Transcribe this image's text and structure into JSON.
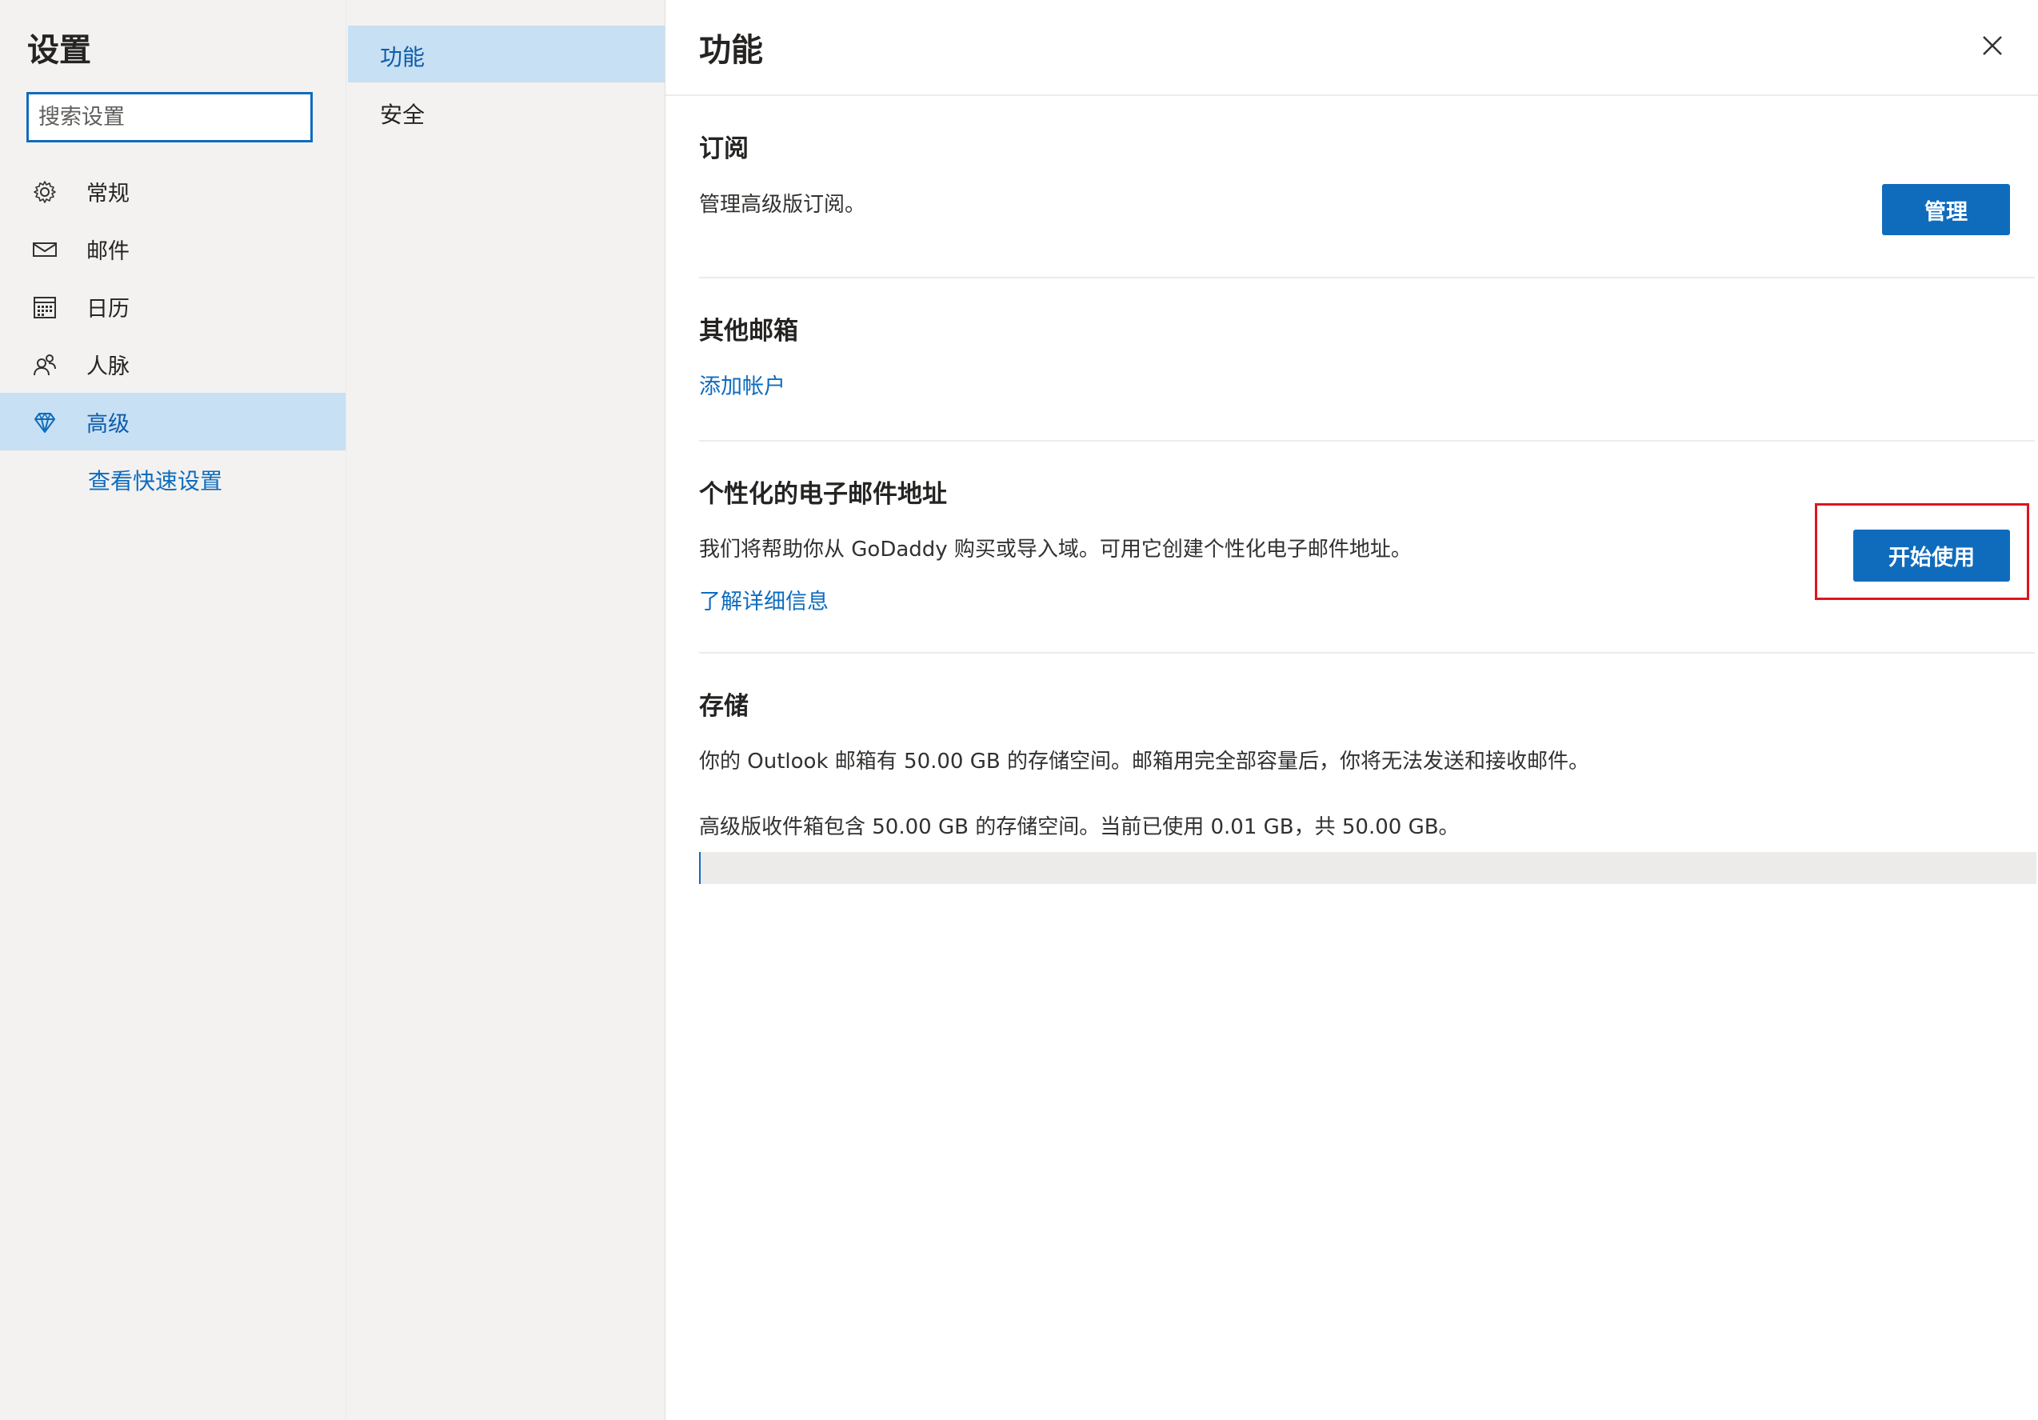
{
  "sidebar": {
    "title": "设置",
    "search_placeholder": "搜索设置",
    "items": [
      {
        "label": "常规",
        "icon": "gear-icon"
      },
      {
        "label": "邮件",
        "icon": "mail-icon"
      },
      {
        "label": "日历",
        "icon": "calendar-icon"
      },
      {
        "label": "人脉",
        "icon": "people-icon"
      },
      {
        "label": "高级",
        "icon": "diamond-icon",
        "selected": true
      }
    ],
    "quick_settings_link": "查看快速设置"
  },
  "subnav": {
    "items": [
      {
        "label": "功能",
        "selected": true
      },
      {
        "label": "安全"
      }
    ]
  },
  "main": {
    "title": "功能",
    "subscription": {
      "title": "订阅",
      "description": "管理高级版订阅。",
      "button": "管理"
    },
    "other_mailboxes": {
      "title": "其他邮箱",
      "link": "添加帐户"
    },
    "personalized_email": {
      "title": "个性化的电子邮件地址",
      "description": "我们将帮助你从 GoDaddy 购买或导入域。可用它创建个性化电子邮件地址。",
      "link": "了解详细信息",
      "button": "开始使用"
    },
    "storage": {
      "title": "存储",
      "description": "你的 Outlook 邮箱有 50.00 GB 的存储空间。邮箱用完全部容量后，你将无法发送和接收邮件。",
      "usage_text": "高级版收件箱包含 50.00 GB 的存储空间。当前已使用 0.01 GB，共 50.00 GB。",
      "used_gb": 0.01,
      "total_gb": 50.0
    }
  },
  "colors": {
    "accent": "#0f6cbd",
    "selected_bg": "#c7e0f4",
    "highlight": "#e0141e"
  }
}
